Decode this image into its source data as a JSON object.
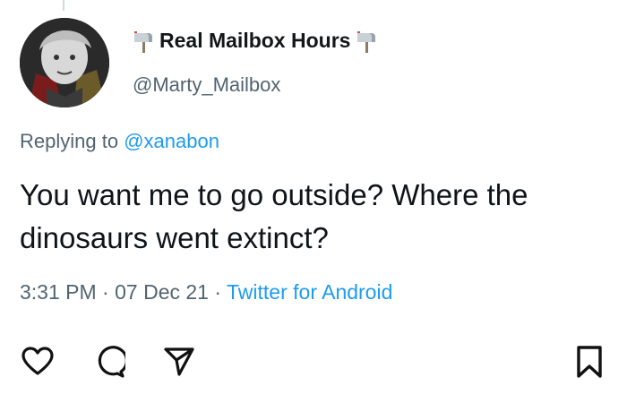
{
  "tweet": {
    "display_name": "Real Mailbox Hours",
    "handle": "@Marty_Mailbox",
    "replying_prefix": "Replying to",
    "replying_to": "@xanabon",
    "text": "You want me to go outside? Where the dinosaurs went extinct?",
    "time": "3:31 PM",
    "separator": "·",
    "date": "07 Dec 21",
    "source": "Twitter for Android"
  },
  "icons": {
    "name_decoration": "mailbox-icon",
    "like": "heart-icon",
    "comment": "speech-bubble-icon",
    "share": "paper-plane-icon",
    "save": "bookmark-icon"
  },
  "colors": {
    "link": "#1d9bf0",
    "secondary_text": "#536471",
    "primary_text": "#0f1419"
  }
}
